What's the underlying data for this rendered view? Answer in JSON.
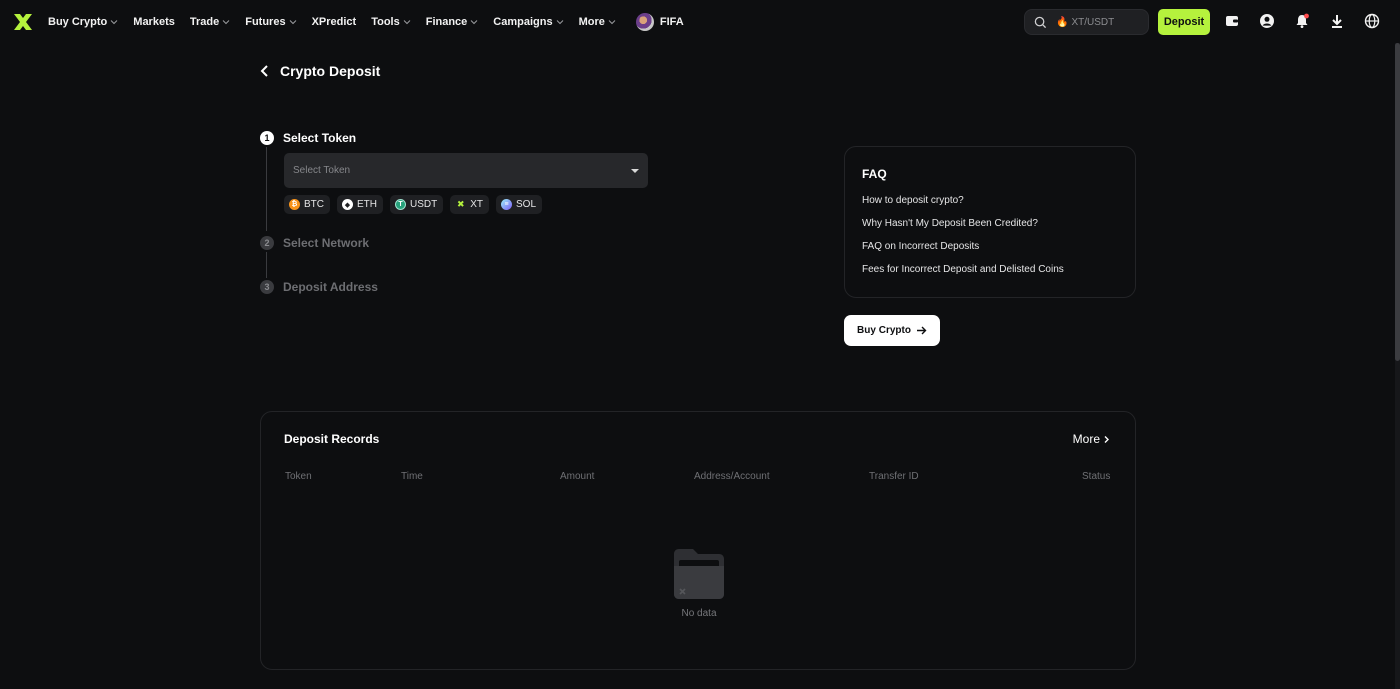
{
  "nav": {
    "menu": [
      {
        "label": "Buy Crypto",
        "dropdown": true
      },
      {
        "label": "Markets",
        "dropdown": false
      },
      {
        "label": "Trade",
        "dropdown": true
      },
      {
        "label": "Futures",
        "dropdown": true
      },
      {
        "label": "XPredict",
        "dropdown": false
      },
      {
        "label": "Tools",
        "dropdown": true
      },
      {
        "label": "Finance",
        "dropdown": true
      },
      {
        "label": "Campaigns",
        "dropdown": true
      },
      {
        "label": "More",
        "dropdown": true
      },
      {
        "label": "FIFA",
        "dropdown": false
      }
    ],
    "search_placeholder": "XT/USDT",
    "deposit_label": "Deposit",
    "icons": [
      "wallet-icon",
      "user-icon",
      "bell-icon",
      "download-icon",
      "globe-icon"
    ],
    "colors": {
      "accent": "#b5f23d",
      "notification": "#ff4d4f",
      "background": "#0d0e10"
    }
  },
  "page": {
    "title": "Crypto Deposit"
  },
  "steps": [
    {
      "num": "1",
      "label": "Select Token",
      "active": true
    },
    {
      "num": "2",
      "label": "Select Network",
      "active": false
    },
    {
      "num": "3",
      "label": "Deposit Address",
      "active": false
    }
  ],
  "token_select": {
    "placeholder": "Select Token"
  },
  "quick_tokens": [
    {
      "symbol": "BTC",
      "icon": "btc-icon",
      "color": "#f7931a"
    },
    {
      "symbol": "ETH",
      "icon": "eth-icon",
      "color": "#ffffff"
    },
    {
      "symbol": "USDT",
      "icon": "usdt-icon",
      "color": "#26a17b"
    },
    {
      "symbol": "XT",
      "icon": "xt-icon",
      "color": "#b5f23d"
    },
    {
      "symbol": "SOL",
      "icon": "sol-icon",
      "color": "#7b5cf5"
    }
  ],
  "faq": {
    "title": "FAQ",
    "items": [
      "How to deposit crypto?",
      "Why Hasn't My Deposit Been Credited?",
      "FAQ on Incorrect Deposits",
      "Fees for Incorrect Deposit and Delisted Coins"
    ]
  },
  "buy_crypto_label": "Buy Crypto",
  "records": {
    "title": "Deposit Records",
    "more_label": "More",
    "columns": [
      "Token",
      "Time",
      "Amount",
      "Address/Account",
      "Transfer ID",
      "Status"
    ],
    "empty_text": "No data"
  }
}
